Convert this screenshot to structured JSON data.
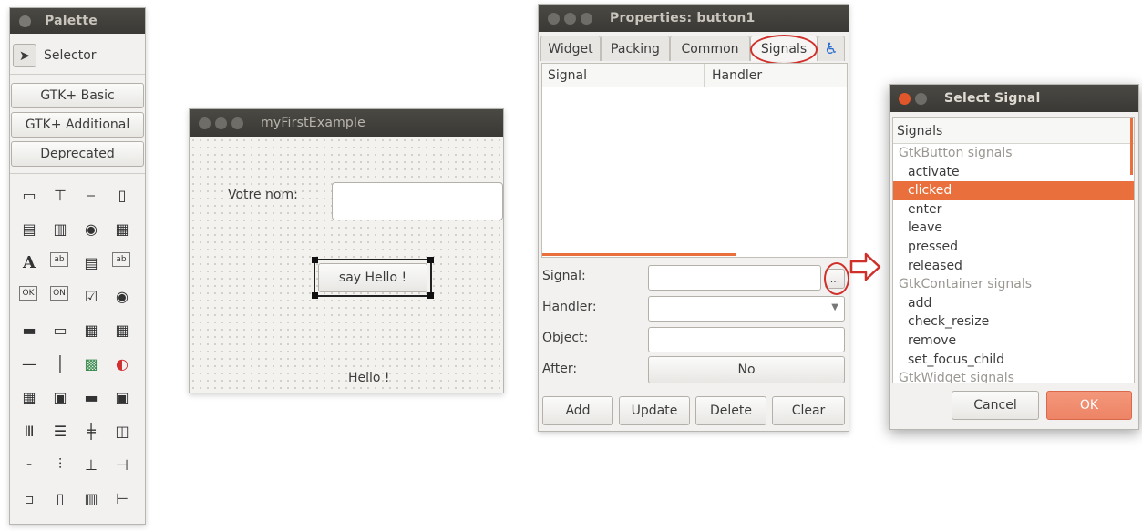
{
  "palette": {
    "title": "Palette",
    "selector_label": "Selector",
    "groups": [
      "GTK+ Basic",
      "GTK+ Additional",
      "Deprecated"
    ],
    "icons": [
      [
        "window-icon",
        "dialog-icon",
        "ruler-icon",
        "frame-icon"
      ],
      [
        "button-row-icon",
        "ok-button-icon",
        "radio-tool-icon",
        "toolbar-icon"
      ],
      [
        "label-icon",
        "entry-icon",
        "text-view-icon",
        "spin-icon"
      ],
      [
        "ok-icon",
        "toggle-icon",
        "check-icon",
        "radio-icon"
      ],
      [
        "combo-icon",
        "combo-entry-icon",
        "table-icon",
        "grid-icon"
      ],
      [
        "hseparator-icon",
        "vseparator-icon",
        "image-icon",
        "color-icon"
      ],
      [
        "calendar-icon",
        "file-chooser-icon",
        "progress-icon",
        "expander-icon"
      ],
      [
        "vbox-icon",
        "hbox-icon",
        "grid-layout-icon",
        "notebook-icon"
      ],
      [
        "hscale-icon",
        "vscale-icon",
        "vscroll-icon",
        "hscroll-icon"
      ],
      [
        "tray-icon",
        "book-icon",
        "fixed-icon",
        "alignment-icon"
      ]
    ],
    "glyphs": [
      [
        "▭",
        "⊤",
        "⎯",
        "▯"
      ],
      [
        "▤",
        "▥",
        "◉",
        "▦"
      ],
      [
        "A",
        "ab",
        "▤",
        "ab"
      ],
      [
        "OK",
        "ON",
        "☑",
        "◉"
      ],
      [
        "▬",
        "▭",
        "▦",
        "▦"
      ],
      [
        "—",
        "│",
        "▩",
        "◐"
      ],
      [
        "▦",
        "▣",
        "▬",
        "▣"
      ],
      [
        "Ⅲ",
        "☰",
        "╪",
        "◫"
      ],
      [
        "⁃",
        "⫶",
        "⊥",
        "⊣"
      ],
      [
        "▫",
        "▯",
        "▥",
        "⊢"
      ]
    ]
  },
  "my_example": {
    "title": "myFirstExample",
    "name_label": "Votre nom:",
    "name_value": "",
    "button_label": "say Hello !",
    "output_label": "Hello !"
  },
  "properties": {
    "title": "Properties: button1",
    "tabs": [
      "Widget",
      "Packing",
      "Common",
      "Signals"
    ],
    "accessibility_icon": "♿",
    "columns": [
      "Signal",
      "Handler"
    ],
    "fields": {
      "signal_label": "Signal:",
      "handler_label": "Handler:",
      "object_label": "Object:",
      "after_label": "After:",
      "signal_value": "",
      "handler_value": "",
      "object_value": "",
      "after_value": "No",
      "ellipsis": "..."
    },
    "buttons": [
      "Add",
      "Update",
      "Delete",
      "Clear"
    ]
  },
  "select_signal": {
    "title": "Select Signal",
    "header": "Signals",
    "rows": [
      {
        "text": "GtkButton signals",
        "kind": "group"
      },
      {
        "text": "activate",
        "kind": "item"
      },
      {
        "text": "clicked",
        "kind": "selected"
      },
      {
        "text": "enter",
        "kind": "item"
      },
      {
        "text": "leave",
        "kind": "item"
      },
      {
        "text": "pressed",
        "kind": "item"
      },
      {
        "text": "released",
        "kind": "item"
      },
      {
        "text": "GtkContainer signals",
        "kind": "group"
      },
      {
        "text": "add",
        "kind": "item"
      },
      {
        "text": "check_resize",
        "kind": "item"
      },
      {
        "text": "remove",
        "kind": "item"
      },
      {
        "text": "set_focus_child",
        "kind": "item"
      },
      {
        "text": "GtkWidget signals",
        "kind": "group"
      }
    ],
    "cancel_label": "Cancel",
    "ok_label": "OK"
  },
  "colors": {
    "accent": "#e9703d",
    "annotation_red": "#d0302a",
    "titlebar": "#3f3e3a"
  }
}
